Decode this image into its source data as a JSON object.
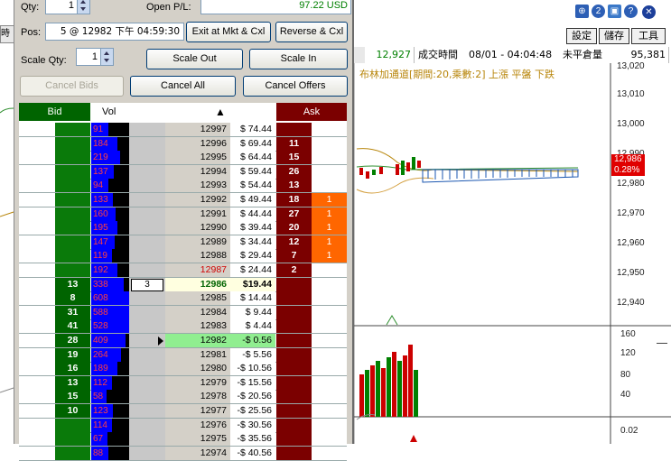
{
  "toolbar": {
    "buttons": [
      "設定",
      "儲存",
      "工具"
    ]
  },
  "quote_bar": {
    "last_price": "12,927",
    "time_label": "成交時間",
    "time_value": "08/01 - 04:04:48",
    "oi_label": "未平倉量",
    "oi_value": "95,381"
  },
  "indicator_legend": "布林加通道[期間:20,乘數:2] 上漲 平盤 下跌",
  "price_axis": {
    "ticks": [
      "13,010",
      "13,000",
      "12,990",
      "12,980",
      "12,970",
      "12,960",
      "12,950",
      "12,940"
    ],
    "top_partial": "13,020",
    "current_price": "12,986",
    "current_change": "0.28%"
  },
  "volume_axis": {
    "ticks": [
      "160",
      "120",
      "80",
      "40"
    ]
  },
  "sub_axis": {
    "ticks": [
      "0.02"
    ]
  },
  "panel": {
    "qty_label": "Qty:",
    "qty_value": "1",
    "open_pl_label": "Open P/L:",
    "open_pl_value": "97.22 USD",
    "pos_label": "Pos:",
    "pos_value": "5 @ 12982 下午 04:59:30",
    "exit_button": "Exit at Mkt & Cxl",
    "reverse_button": "Reverse & Cxl",
    "scale_qty_label": "Scale Qty:",
    "scale_qty_value": "1",
    "scale_out_button": "Scale Out",
    "scale_in_button": "Scale In",
    "cancel_bids_button": "Cancel Bids",
    "cancel_all_button": "Cancel All",
    "cancel_offers_button": "Cancel Offers"
  },
  "ladder": {
    "headers": {
      "bid": "Bid",
      "vol": "Vol",
      "sort": "▲",
      "ask": "Ask"
    },
    "rows": [
      {
        "bid": "",
        "vol": "91",
        "order": "",
        "price": "12997",
        "pl": "$ 74.44",
        "ask": "",
        "myask": "",
        "vol_frac": 0.45
      },
      {
        "bid": "",
        "vol": "184",
        "order": "",
        "price": "12996",
        "pl": "$ 69.44",
        "ask": "11",
        "myask": "",
        "vol_frac": 0.7
      },
      {
        "bid": "",
        "vol": "219",
        "order": "",
        "price": "12995",
        "pl": "$ 64.44",
        "ask": "15",
        "myask": "",
        "vol_frac": 0.75
      },
      {
        "bid": "",
        "vol": "137",
        "order": "",
        "price": "12994",
        "pl": "$ 59.44",
        "ask": "26",
        "myask": "",
        "vol_frac": 0.6
      },
      {
        "bid": "",
        "vol": "94",
        "order": "",
        "price": "12993",
        "pl": "$ 54.44",
        "ask": "13",
        "myask": "",
        "vol_frac": 0.45
      },
      {
        "bid": "",
        "vol": "133",
        "order": "",
        "price": "12992",
        "pl": "$ 49.44",
        "ask": "18",
        "myask": "1",
        "vol_frac": 0.58
      },
      {
        "bid": "",
        "vol": "160",
        "order": "",
        "price": "12991",
        "pl": "$ 44.44",
        "ask": "27",
        "myask": "1",
        "vol_frac": 0.65
      },
      {
        "bid": "",
        "vol": "195",
        "order": "",
        "price": "12990",
        "pl": "$ 39.44",
        "ask": "20",
        "myask": "1",
        "vol_frac": 0.7
      },
      {
        "bid": "",
        "vol": "147",
        "order": "",
        "price": "12989",
        "pl": "$ 34.44",
        "ask": "12",
        "myask": "1",
        "vol_frac": 0.62
      },
      {
        "bid": "",
        "vol": "119",
        "order": "",
        "price": "12988",
        "pl": "$ 29.44",
        "ask": "7",
        "myask": "1",
        "vol_frac": 0.55
      },
      {
        "bid": "",
        "vol": "192",
        "order": "",
        "price": "12987",
        "pl": "$ 24.44",
        "ask": "2",
        "myask": "",
        "vol_frac": 0.7,
        "price_color": "#d00000"
      },
      {
        "bid": "13",
        "vol": "338",
        "order": "3",
        "price": "12986",
        "pl": "$19.44",
        "ask": "",
        "myask": "",
        "vol_frac": 0.85,
        "current": true
      },
      {
        "bid": "8",
        "vol": "608",
        "order": "",
        "price": "12985",
        "pl": "$ 14.44",
        "ask": "",
        "myask": "",
        "vol_frac": 1.0
      },
      {
        "bid": "31",
        "vol": "588",
        "order": "",
        "price": "12984",
        "pl": "$ 9.44",
        "ask": "",
        "myask": "",
        "vol_frac": 1.0
      },
      {
        "bid": "41",
        "vol": "528",
        "order": "",
        "price": "12983",
        "pl": "$ 4.44",
        "ask": "",
        "myask": "",
        "vol_frac": 1.0
      },
      {
        "bid": "28",
        "vol": "409",
        "order": "",
        "price": "12982",
        "pl": "-$ 0.56",
        "ask": "",
        "myask": "",
        "vol_frac": 0.9,
        "entry": true
      },
      {
        "bid": "19",
        "vol": "264",
        "order": "",
        "price": "12981",
        "pl": "-$ 5.56",
        "ask": "",
        "myask": "",
        "vol_frac": 0.78
      },
      {
        "bid": "16",
        "vol": "189",
        "order": "",
        "price": "12980",
        "pl": "-$ 10.56",
        "ask": "",
        "myask": "",
        "vol_frac": 0.7
      },
      {
        "bid": "13",
        "vol": "112",
        "order": "",
        "price": "12979",
        "pl": "-$ 15.56",
        "ask": "",
        "myask": "",
        "vol_frac": 0.55
      },
      {
        "bid": "15",
        "vol": "58",
        "order": "",
        "price": "12978",
        "pl": "-$ 20.56",
        "ask": "",
        "myask": "",
        "vol_frac": 0.4
      },
      {
        "bid": "10",
        "vol": "123",
        "order": "",
        "price": "12977",
        "pl": "-$ 25.56",
        "ask": "",
        "myask": "",
        "vol_frac": 0.58
      },
      {
        "bid": "",
        "vol": "114",
        "order": "",
        "price": "12976",
        "pl": "-$ 30.56",
        "ask": "",
        "myask": "",
        "vol_frac": 0.55
      },
      {
        "bid": "",
        "vol": "67",
        "order": "",
        "price": "12975",
        "pl": "-$ 35.56",
        "ask": "",
        "myask": "",
        "vol_frac": 0.42
      },
      {
        "bid": "",
        "vol": "88",
        "order": "",
        "price": "12974",
        "pl": "-$ 40.56",
        "ask": "",
        "myask": "",
        "vol_frac": 0.45
      }
    ]
  },
  "colors": {
    "bid_green": "#006400",
    "ask_red": "#7b0000",
    "vol_blue": "#0000ff",
    "my_order_orange": "#ff6600",
    "current_row": "#ffffe0",
    "entry_row": "#90ee90"
  }
}
